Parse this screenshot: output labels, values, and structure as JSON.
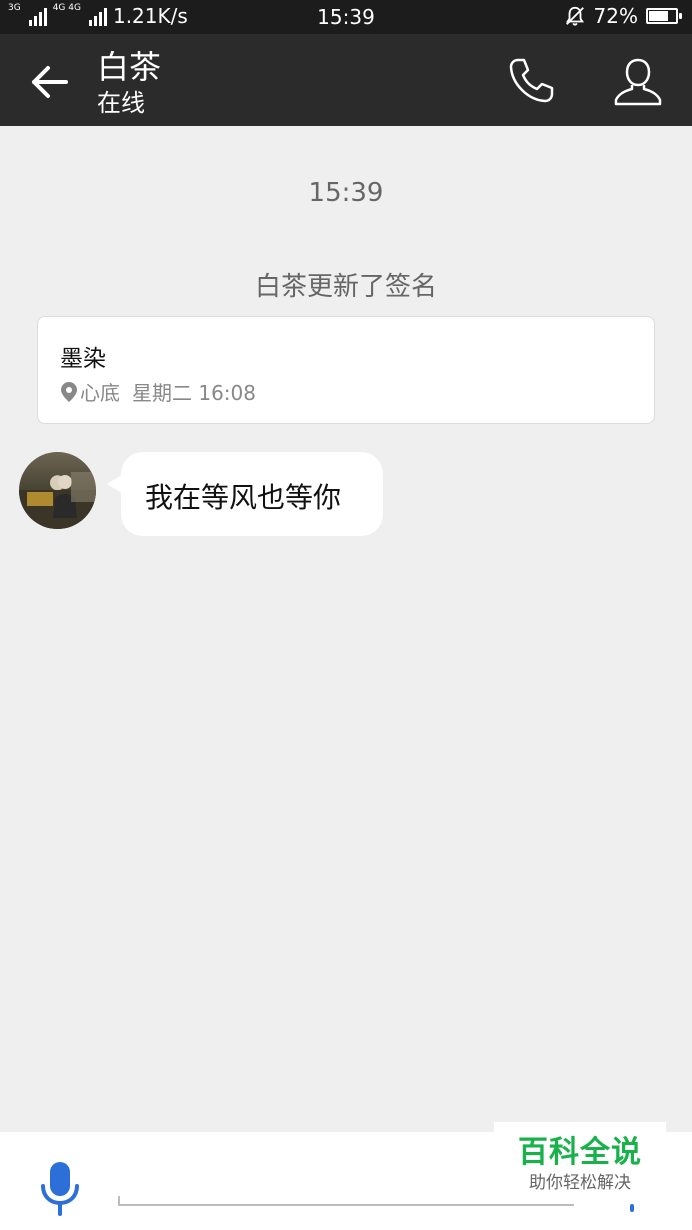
{
  "status_bar": {
    "sim1_label": "3G",
    "sim2_label": "4G 4G",
    "speed": "1.21K/s",
    "time": "15:39",
    "battery_percent": "72%",
    "battery_level": 0.72,
    "icons": [
      "signal-icon",
      "signal-icon",
      "bell-muted-icon",
      "battery-icon"
    ]
  },
  "header": {
    "contact_name": "白茶",
    "contact_status": "在线",
    "icons": [
      "back-arrow-icon",
      "phone-icon",
      "user-profile-icon"
    ]
  },
  "chat": {
    "time_divider": "15:39",
    "system_note": "白茶更新了签名",
    "signature_card": {
      "text": "墨染",
      "location": "心底",
      "date": "星期二 16:08"
    },
    "messages": [
      {
        "sender": "contact",
        "text": "我在等风也等你"
      }
    ]
  },
  "input_bar": {
    "icons": [
      "microphone-icon"
    ],
    "accent_color": "#2d6fd8"
  },
  "watermark": {
    "title": "百科全说",
    "subtitle": "助你轻松解决",
    "color": "#19b14a"
  }
}
